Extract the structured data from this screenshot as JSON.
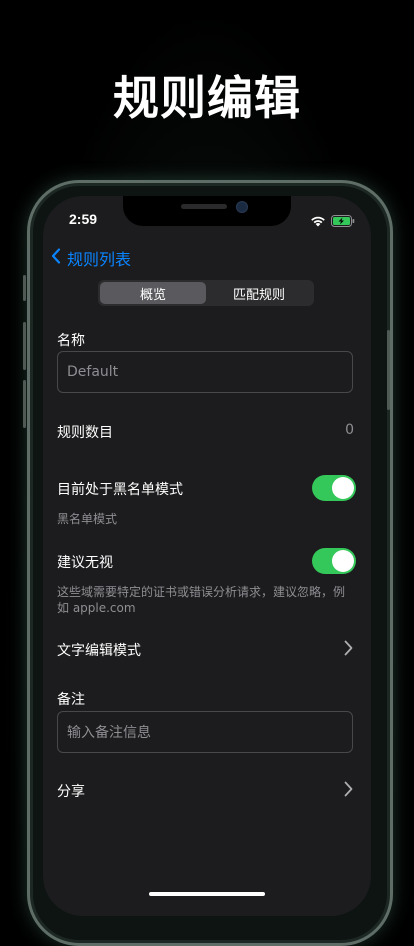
{
  "headline": "规则编辑",
  "status": {
    "time": "2:59"
  },
  "nav": {
    "back_label": "规则列表"
  },
  "tabs": [
    {
      "label": "概览",
      "active": true
    },
    {
      "label": "匹配规则",
      "active": false
    }
  ],
  "name": {
    "label": "名称",
    "placeholder": "Default"
  },
  "rule_count": {
    "label": "规则数目",
    "value": "0"
  },
  "blacklist": {
    "label": "目前处于黑名单模式",
    "on": true,
    "hint": "黑名单模式"
  },
  "ignore": {
    "label": "建议无视",
    "on": true,
    "hint_line1": "这些域需要特定的证书或错误分析请求，建议忽略，例",
    "hint_line2": "如 apple.com"
  },
  "text_mode": {
    "label": "文字编辑模式"
  },
  "note": {
    "label": "备注",
    "placeholder": "输入备注信息"
  },
  "share": {
    "label": "分享"
  },
  "colors": {
    "accent": "#0a84ff",
    "toggle_on": "#34c759",
    "background": "#1c1c1e"
  }
}
